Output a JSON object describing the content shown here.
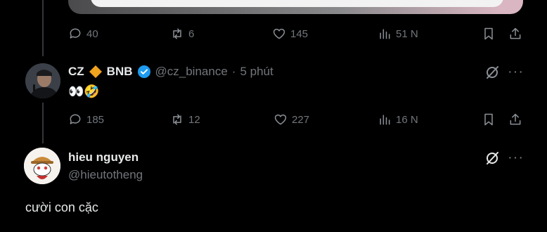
{
  "tweet_top": {
    "stats": {
      "replies": "40",
      "retweets": "6",
      "likes": "145",
      "views": "51 N"
    }
  },
  "tweet_cz": {
    "display_name": "CZ",
    "name_suffix": "BNB",
    "handle": "@cz_binance",
    "separator": "·",
    "time": "5 phút",
    "text": "👀🤣",
    "stats": {
      "replies": "185",
      "retweets": "12",
      "likes": "227",
      "views": "16 N"
    }
  },
  "tweet_hieu": {
    "display_name": "hieu nguyen",
    "handle": "@hieutotheng",
    "text": "cười con cặc"
  },
  "more_label": "···",
  "colors": {
    "verified": "#1d9bf0",
    "bnb": "#f0a31f",
    "muted": "#71767b",
    "background": "#000000"
  },
  "icons": [
    "reply-icon",
    "retweet-icon",
    "like-icon",
    "views-icon",
    "bookmark-icon",
    "share-icon",
    "grok-icon",
    "more-icon",
    "verified-badge-icon",
    "bnb-diamond-icon"
  ]
}
